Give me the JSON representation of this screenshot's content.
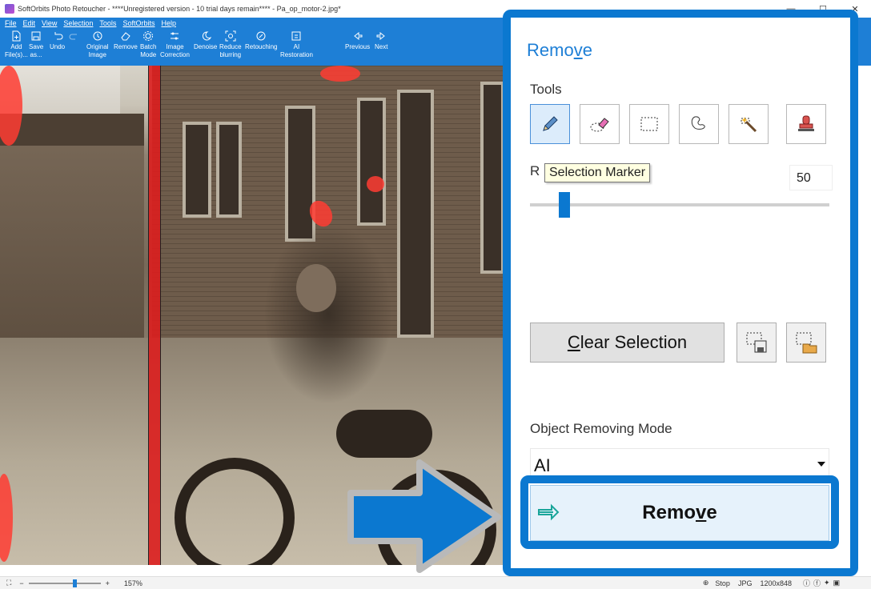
{
  "window": {
    "title": "SoftOrbits Photo Retoucher - ****Unregistered version - 10 trial days remain**** - Pa_op_motor-2.jpg*",
    "minimize": "—",
    "maximize": "☐",
    "close": "✕"
  },
  "menu": [
    "File",
    "Edit",
    "View",
    "Selection",
    "Tools",
    "SoftOrbits",
    "Help"
  ],
  "toolbar": {
    "add_files": "Add\nFile(s)...",
    "save_as": "Save\nas...",
    "undo": "Undo",
    "original_image": "Original\nImage",
    "remove": "Remove",
    "batch_mode": "Batch\nMode",
    "image_correction": "Image\nCorrection",
    "denoise": "Denoise",
    "reduce_blurring": "Reduce\nblurring",
    "retouching": "Retouching",
    "ai_restoration": "AI\nRestoration",
    "previous": "Previous",
    "next": "Next"
  },
  "statusbar": {
    "zoom_minus": "−",
    "zoom_plus": "+",
    "zoom_percent": "157%",
    "zoom_fraction": 0.65,
    "stop": "Stop",
    "format": "JPG",
    "dimensions": "1200x848"
  },
  "panel": {
    "title_pre": "Remo",
    "title_ul": "v",
    "title_post": "e",
    "tools_label": "Tools",
    "tooltip": "Selection Marker",
    "radius_label_visible": "R",
    "radius_value": "50",
    "radius_fraction": 0.1,
    "clear_pre": "",
    "clear_ul": "C",
    "clear_post": "lear Selection",
    "mode_label": "Object Removing Mode",
    "mode_value": "AI",
    "remove_pre": "Remo",
    "remove_ul": "v",
    "remove_post": "e"
  },
  "colors": {
    "accent": "#0b78d0",
    "ribbon": "#1e7fd6",
    "marker": "#ff3c32"
  }
}
